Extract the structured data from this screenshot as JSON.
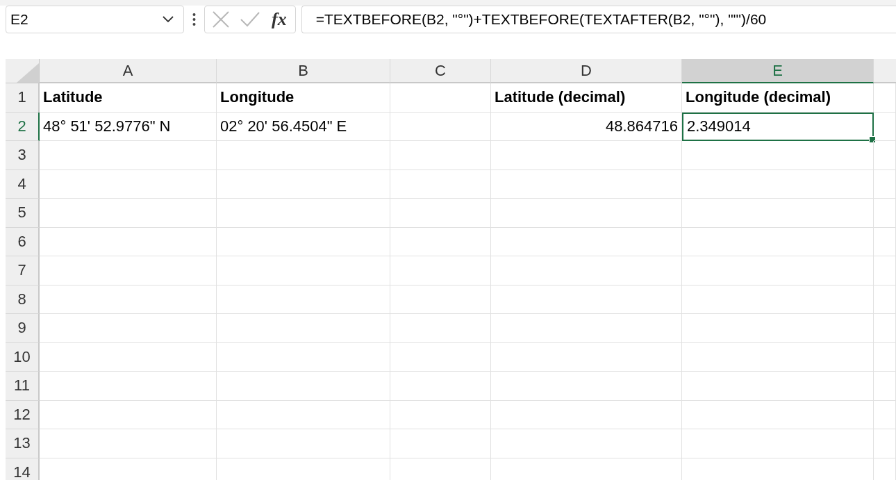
{
  "formula_bar": {
    "name_box": "E2",
    "insert_function_label": "fx",
    "formula": "=TEXTBEFORE(B2, \"°\")+TEXTBEFORE(TEXTAFTER(B2, \"°\"), \"'\")/60"
  },
  "columns": [
    {
      "label": "A",
      "selected": false
    },
    {
      "label": "B",
      "selected": false
    },
    {
      "label": "C",
      "selected": false
    },
    {
      "label": "D",
      "selected": false
    },
    {
      "label": "E",
      "selected": true
    }
  ],
  "rows": [
    {
      "number": "1",
      "selected": false,
      "cells": [
        {
          "kind": "text",
          "text": "Latitude",
          "bold": true,
          "active": false
        },
        {
          "kind": "text",
          "text": "Longitude",
          "bold": true,
          "active": false
        },
        null,
        {
          "kind": "text",
          "text": "Latitude (decimal)",
          "bold": true,
          "active": false
        },
        {
          "kind": "text",
          "text": "Longitude (decimal)",
          "bold": true,
          "active": false
        }
      ]
    },
    {
      "number": "2",
      "selected": true,
      "cells": [
        {
          "kind": "text",
          "text": "48° 51' 52.9776\" N",
          "bold": false,
          "active": false
        },
        {
          "kind": "text",
          "text": "02° 20' 56.4504\" E",
          "bold": false,
          "active": false
        },
        null,
        {
          "kind": "number",
          "text": "48.864716",
          "bold": false,
          "active": false
        },
        {
          "kind": "text",
          "text": "2.349014",
          "bold": false,
          "active": true
        }
      ]
    },
    {
      "number": "3",
      "selected": false
    },
    {
      "number": "4",
      "selected": false
    },
    {
      "number": "5",
      "selected": false
    },
    {
      "number": "6",
      "selected": false
    },
    {
      "number": "7",
      "selected": false
    },
    {
      "number": "8",
      "selected": false
    },
    {
      "number": "9",
      "selected": false
    },
    {
      "number": "10",
      "selected": false
    },
    {
      "number": "11",
      "selected": false
    },
    {
      "number": "12",
      "selected": false
    },
    {
      "number": "13",
      "selected": false
    },
    {
      "number": "14",
      "selected": false
    }
  ]
}
